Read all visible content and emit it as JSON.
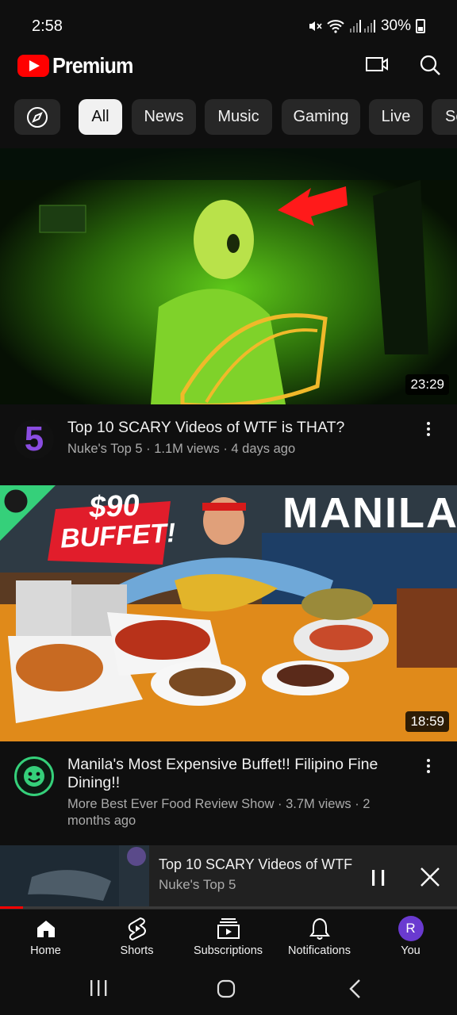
{
  "status_bar": {
    "time": "2:58",
    "battery": "30%"
  },
  "header": {
    "brand": "Premium",
    "cast_icon": "cast-icon",
    "search_icon": "search-icon"
  },
  "chips": {
    "explore_icon": "compass-icon",
    "items": [
      "All",
      "News",
      "Music",
      "Gaming",
      "Live",
      "Sc"
    ],
    "selected": "All"
  },
  "videos": [
    {
      "title": "Top 10 SCARY Videos of WTF is THAT?",
      "subtitle": "Nuke's Top 5 · 1.1M views · 4 days ago",
      "duration": "23:29",
      "avatar_text": "5"
    },
    {
      "title": "Manila's Most Expensive Buffet!! Filipino Fine Dining!!",
      "subtitle": "More Best Ever Food Review Show · 3.7M views · 2 months ago",
      "duration": "18:59",
      "overlay_price": "$90",
      "overlay_buffet": "BUFFET!",
      "overlay_city": "MANILA"
    }
  ],
  "mini_player": {
    "title": "Top 10 SCARY Videos of WTF i..",
    "channel": "Nuke's Top 5",
    "progress": 0.05
  },
  "bottom_nav": {
    "items": [
      "Home",
      "Shorts",
      "Subscriptions",
      "Notifications",
      "You"
    ],
    "avatar_letter": "R"
  },
  "colors": {
    "accent": "#ff0000",
    "background": "#0f0f0f",
    "chip": "#272727",
    "avatar": "#6a3ad0"
  }
}
